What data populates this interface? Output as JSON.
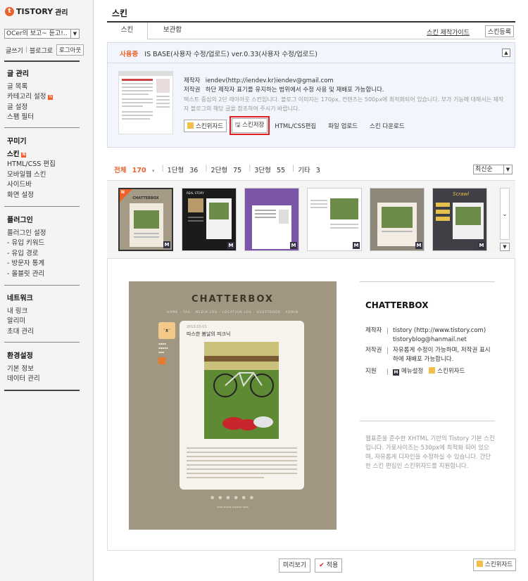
{
  "brand": {
    "logo": "TISTORY",
    "section": "관리"
  },
  "sidebar": {
    "blog_select": "OCer의 보고~ 듣고!..",
    "write": "글쓰기",
    "blog_link": "블로그로",
    "logout": "로그아웃",
    "groups": [
      {
        "title": "글 관리",
        "items": [
          "글 목록",
          "카테고리 설정",
          "글 설정",
          "스팸 필터"
        ]
      },
      {
        "title": "꾸미기",
        "items": [
          "스킨",
          "HTML/CSS 편집",
          "모바일웹 스킨",
          "사이드바",
          "화면 설정"
        ]
      },
      {
        "title": "플러그인",
        "items": [
          "플러그인 설정",
          "- 유입 키워드",
          "- 유입 경로",
          "- 방문자 통계",
          "- 올블릿 관리"
        ]
      },
      {
        "title": "네트워크",
        "items": [
          "내 링크",
          "알리미",
          "초대 관리"
        ]
      },
      {
        "title": "환경설정",
        "items": [
          "기본 정보",
          "데이터 관리"
        ]
      }
    ]
  },
  "page": {
    "title": "스킨"
  },
  "tabs": {
    "active": "스킨",
    "other": "보관함",
    "guide": "스킨 제작가이드",
    "register": "스킨등록"
  },
  "current_skin": {
    "label": "사용중",
    "name": "IS BASE(사용자 수정/업로드) ver.0.33(사용자 수정/업로드)",
    "maker_key": "제작자",
    "maker": "iendev(http://iendev.kr)iendev@gmail.com",
    "copyright_key": "저작권",
    "copyright": "하단 제작자 표기를 유지하는 범위에서 수정 사용 및 재배포 가능합니다.",
    "description": "텍스트 중심의 2단 레이아웃 스킨입니다. 블로그 이미지는 170px, 컨텐츠는 500px에 최적화되어 있습니다. 부가 기능에 대해서는 제작자 블로그의 해당 글을 참조하여 주시기 바랍니다.",
    "actions": [
      "스킨위자드",
      "스킨저장",
      "HTML/CSS편집",
      "파일 업로드",
      "스킨 다운로드"
    ]
  },
  "filter": {
    "items": [
      {
        "label": "전체",
        "count": "170"
      },
      {
        "label": "1단형",
        "count": "36"
      },
      {
        "label": "2단형",
        "count": "75"
      },
      {
        "label": "3단형",
        "count": "55"
      },
      {
        "label": "기타",
        "count": "3"
      }
    ],
    "sort": "최신순"
  },
  "gallery": {
    "badge": "N",
    "mark": "M",
    "thumbs": [
      "CHATTERBOX",
      "REAL STORY",
      "",
      "",
      "",
      "Scrawl"
    ]
  },
  "preview": {
    "site_title": "CHATTERBOX",
    "nav": "HOME · TAG · MEDIA LOG · LOCATION LOG · GUESTBOOK · ADMIN",
    "post_title": "따스한 봄날의 피크닉",
    "post_date": "2013.03.01",
    "dots": "● ● ● ● ● ●"
  },
  "detail": {
    "name": "CHATTERBOX",
    "maker_key": "제작자",
    "maker": "tistory (http://www.tistory.com) tistoryblog@hanmail.net",
    "copyright_key": "저작권",
    "copyright": "자유롭게 수정이 가능하며, 저작권 표시하에 재배포 가능합니다.",
    "support_key": "지원",
    "support_menu": "메뉴설정",
    "support_wizard": "스킨위자드",
    "description": "웹표준을 준수한 XHTML 기반의 Tistory 기본 스킨입니다. 가로사이즈는 530px에 최적화 되어 있으며, 자유롭게 디자인을 수정하실 수 있습니다. 간단한 스킨 편집인 스킨위자드를 지원합니다."
  },
  "bottom": {
    "preview": "미리보기",
    "apply": "적용",
    "wizard": "스킨위자드"
  },
  "colors": {
    "accent": "#e8622c",
    "highlight": "#e02020",
    "panel": "#f2f5fb"
  }
}
